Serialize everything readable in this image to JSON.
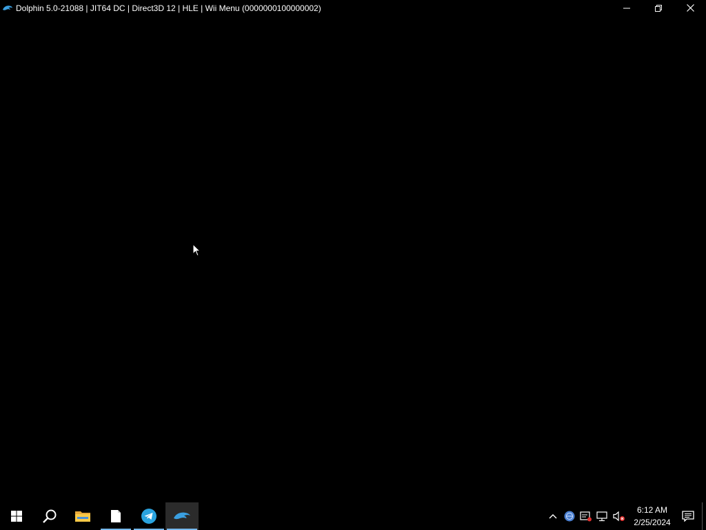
{
  "window": {
    "title": "Dolphin 5.0-21088 | JIT64 DC | Direct3D 12 | HLE | Wii Menu (0000000100000002)",
    "icon": "dolphin-icon",
    "controls": [
      "minimize-icon",
      "restore-icon",
      "close-icon"
    ]
  },
  "taskbar": {
    "buttons": [
      {
        "name": "start-button",
        "icon": "windows-logo-icon"
      },
      {
        "name": "search-button",
        "icon": "search-icon"
      },
      {
        "name": "file-explorer-button",
        "icon": "folder-icon"
      },
      {
        "name": "document-button",
        "icon": "document-icon",
        "running": true
      },
      {
        "name": "telegram-button",
        "icon": "telegram-icon",
        "running": true
      },
      {
        "name": "dolphin-button",
        "icon": "dolphin-icon",
        "running": true,
        "active": true
      }
    ],
    "tray": {
      "icons": [
        "chevron-up-icon",
        "language-icon",
        "security-icon",
        "network-icon",
        "volume-muted-icon"
      ],
      "time": "6:12 AM",
      "date": "2/25/2024",
      "notification_icon": "action-center-icon"
    }
  },
  "colors": {
    "background": "#000000",
    "taskbar_accent": "#76b9ed",
    "dolphin_blue": "#3a9fe0",
    "telegram_blue": "#2aa3df",
    "folder_yellow": "#f8c948"
  }
}
